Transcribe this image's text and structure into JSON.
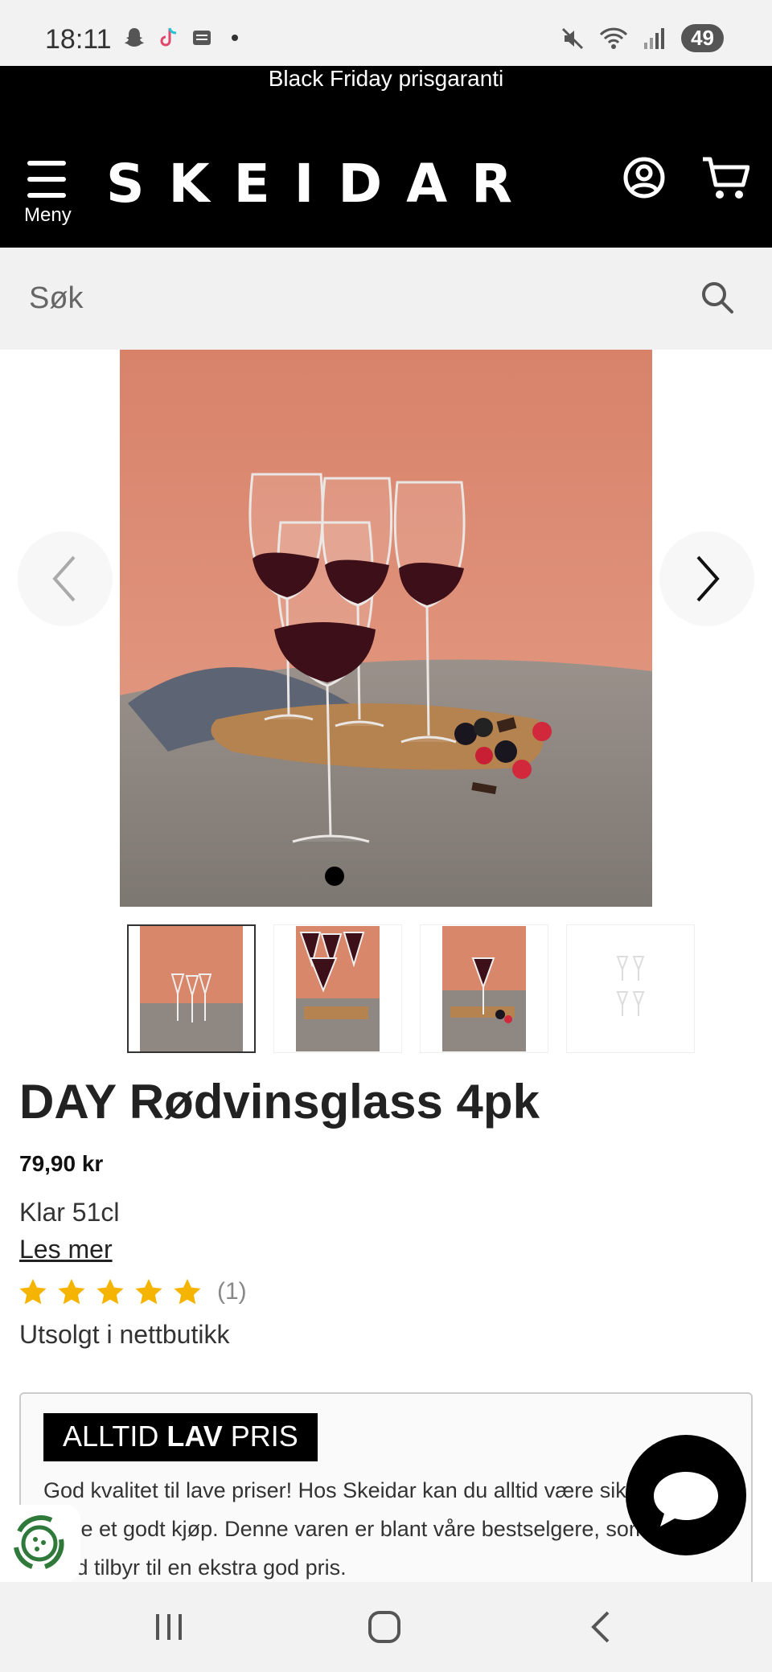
{
  "status_bar": {
    "time": "18:11",
    "battery": "49"
  },
  "promo_banner": {
    "text": "Black Friday prisgaranti"
  },
  "header": {
    "logo": "SKEIDAR",
    "menu_label": "Meny"
  },
  "search": {
    "placeholder": "Søk"
  },
  "product": {
    "title": "DAY Rødvinsglass 4pk",
    "price": "79,90 kr",
    "variant": "Klar 51cl",
    "read_more": "Les mer",
    "rating": 5,
    "review_count": "(1)",
    "stock_status": "Utsolgt i nettbutikk"
  },
  "promo_box": {
    "badge_prefix": "ALLTID ",
    "badge_bold": "LAV",
    "badge_suffix": " PRIS",
    "text": "God kvalitet til lave priser! Hos Skeidar kan du alltid være sikker på å gjøre et godt kjøp. Denne varen er blant våre bestselgere, som vi alltid tilbyr til en ekstra god pris."
  },
  "gallery": {
    "image_count": 4,
    "active_index": 0
  },
  "colors": {
    "accent": "#000000",
    "star": "#f5b400",
    "image_bg": "#d9876a"
  }
}
